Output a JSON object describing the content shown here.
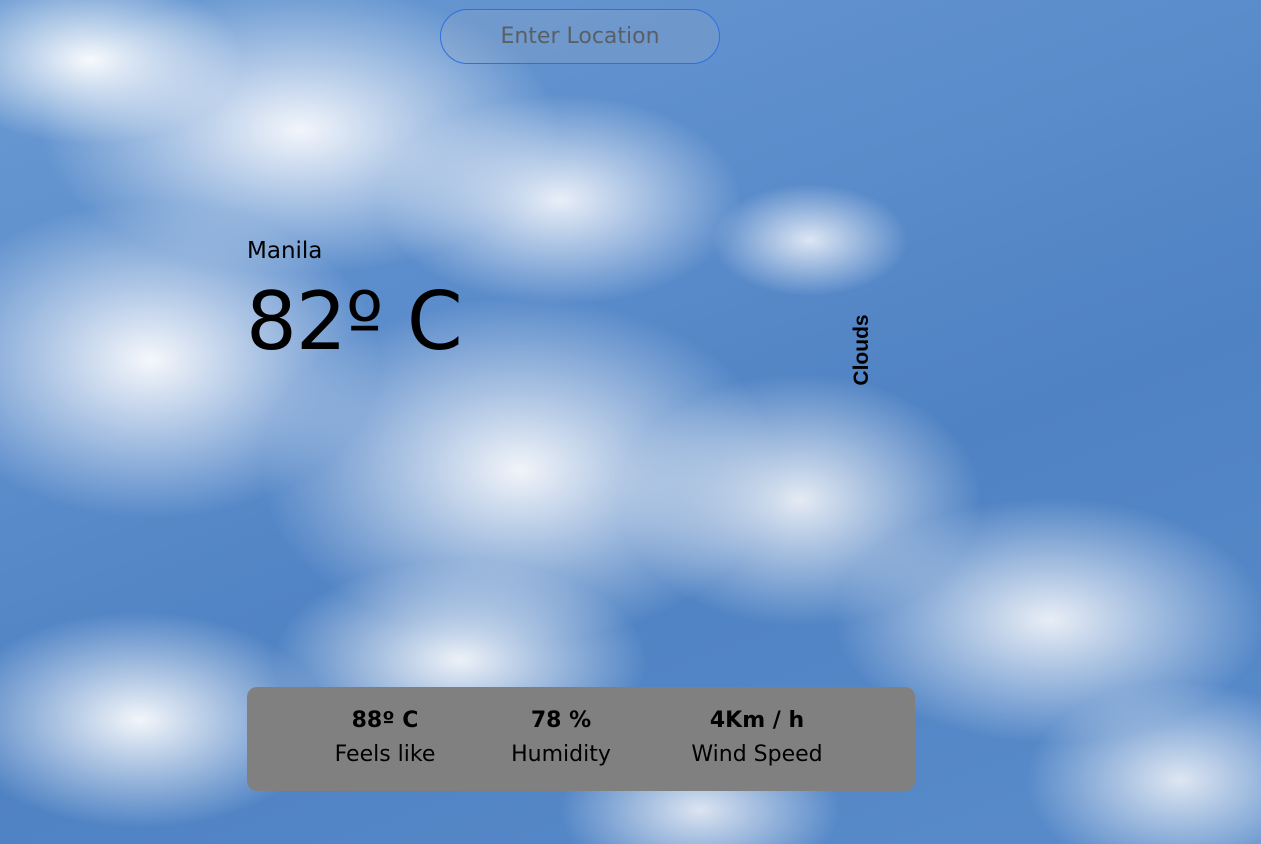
{
  "search": {
    "placeholder": "Enter Location"
  },
  "weather": {
    "location": "Manila",
    "temperature": "82º C",
    "condition": "Clouds"
  },
  "stats": {
    "feels_like": {
      "value": "88º C",
      "label": "Feels like"
    },
    "humidity": {
      "value": "78 %",
      "label": "Humidity"
    },
    "wind_speed": {
      "value": "4Km / h",
      "label": "Wind Speed"
    }
  },
  "colors": {
    "input_border": "#2f6fe0",
    "stats_panel": "#808080",
    "sky": "#5b8ccb"
  }
}
